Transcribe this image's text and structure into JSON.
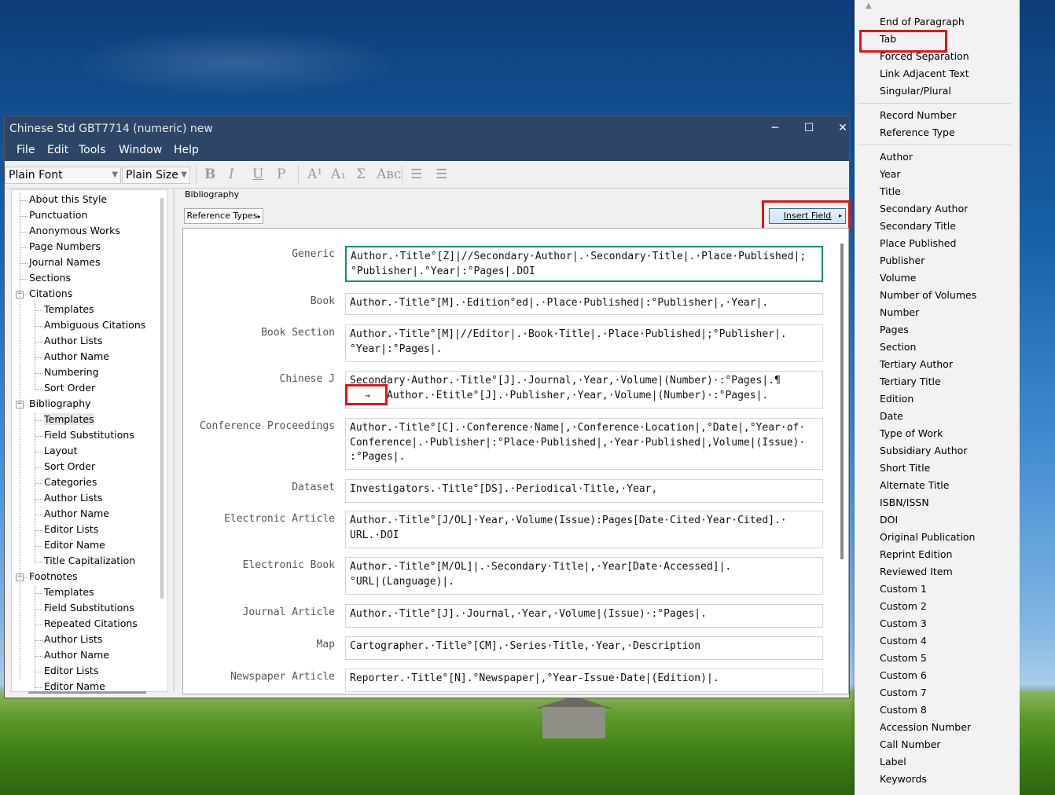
{
  "window": {
    "title": "Chinese Std GBT7714 (numeric) new",
    "controls": {
      "minimize": "─",
      "maximize": "☐",
      "close": "✕"
    }
  },
  "menu": [
    "File",
    "Edit",
    "Tools",
    "Window",
    "Help"
  ],
  "toolbar": {
    "font_value": "Plain Font",
    "size_value": "Plain Size",
    "bold": "B",
    "italic": "I",
    "underline": "U",
    "plain": "P",
    "superscript": "A¹",
    "subscript": "A₁",
    "symbol": "Σ",
    "smallcaps": "Aʙᴄ",
    "align_left": "☰",
    "justify": "☰"
  },
  "tree": [
    {
      "label": "About this Style",
      "level": 0
    },
    {
      "label": "Punctuation",
      "level": 0
    },
    {
      "label": "Anonymous Works",
      "level": 0
    },
    {
      "label": "Page Numbers",
      "level": 0
    },
    {
      "label": "Journal Names",
      "level": 0
    },
    {
      "label": "Sections",
      "level": 0
    },
    {
      "label": "Citations",
      "level": 0,
      "expanded": true
    },
    {
      "label": "Templates",
      "level": 1
    },
    {
      "label": "Ambiguous Citations",
      "level": 1
    },
    {
      "label": "Author Lists",
      "level": 1
    },
    {
      "label": "Author Name",
      "level": 1
    },
    {
      "label": "Numbering",
      "level": 1
    },
    {
      "label": "Sort Order",
      "level": 1
    },
    {
      "label": "Bibliography",
      "level": 0,
      "expanded": true
    },
    {
      "label": "Templates",
      "level": 1,
      "selected": true
    },
    {
      "label": "Field Substitutions",
      "level": 1
    },
    {
      "label": "Layout",
      "level": 1
    },
    {
      "label": "Sort Order",
      "level": 1
    },
    {
      "label": "Categories",
      "level": 1
    },
    {
      "label": "Author Lists",
      "level": 1
    },
    {
      "label": "Author Name",
      "level": 1
    },
    {
      "label": "Editor Lists",
      "level": 1
    },
    {
      "label": "Editor Name",
      "level": 1
    },
    {
      "label": "Title Capitalization",
      "level": 1
    },
    {
      "label": "Footnotes",
      "level": 0,
      "expanded": true
    },
    {
      "label": "Templates",
      "level": 1
    },
    {
      "label": "Field Substitutions",
      "level": 1
    },
    {
      "label": "Repeated Citations",
      "level": 1
    },
    {
      "label": "Author Lists",
      "level": 1
    },
    {
      "label": "Author Name",
      "level": 1
    },
    {
      "label": "Editor Lists",
      "level": 1
    },
    {
      "label": "Editor Name",
      "level": 1
    }
  ],
  "bibliography": {
    "section_label": "Bibliography",
    "reference_types_button": "Reference Types",
    "insert_field_button": "Insert Field",
    "tab_symbol": "→",
    "templates": [
      {
        "type": "Generic",
        "text": "Author.·Title°[Z]|//Secondary·Author|.·Secondary·Title|.·Place·Published|;°Publisher|.°Year|:°Pages|.DOI",
        "active": true
      },
      {
        "type": "Book",
        "text": "Author.·Title°[M].·Edition°ed|.·Place·Published|:°Publisher|,·Year|."
      },
      {
        "type": "Book Section",
        "text": "Author.·Title°[M]|//Editor|.·Book·Title|.·Place·Published|;°Publisher|.\n°Year|:°Pages|."
      },
      {
        "type": "Chinese J",
        "text": "Secondary·Author.·Title°[J].·Journal,·Year,·Volume|(Number)·:°Pages|.¶",
        "text2": "Author.·Etitle°[J].·Publisher,·Year,·Volume|(Number)·:°Pages|."
      },
      {
        "type": "Conference Proceedings",
        "text": "Author.·Title°[C].·Conference·Name|,·Conference·Location|,°Date|,°Year·of·\nConference|.·Publisher|:°Place·Published|,·Year·Published|,Volume|(Issue)·\n:°Pages|."
      },
      {
        "type": "Dataset",
        "text": "Investigators.·Title°[DS].·Periodical·Title,·Year,"
      },
      {
        "type": "Electronic Article",
        "text": "Author.·Title°[J/OL]·Year,·Volume(Issue):Pages[Date·Cited·Year·Cited].·\nURL.·DOI"
      },
      {
        "type": "Electronic Book",
        "text": "Author.·Title°[M/OL]|.·Secondary·Title|,·Year[Date·Accessed]|.\n°URL|(Language)|."
      },
      {
        "type": "Journal Article",
        "text": "Author.·Title°[J].·Journal,·Year,·Volume|(Issue)·:°Pages|."
      },
      {
        "type": "Map",
        "text": "Cartographer.·Title°[CM].·Series·Title,·Year,·Description"
      },
      {
        "type": "Newspaper Article",
        "text": "Reporter.·Title°[N].°Newspaper|,°Year-Issue·Date|(Edition)|."
      }
    ]
  },
  "insert_field_menu": {
    "group1": [
      "End of Paragraph",
      "Tab",
      "Forced Separation",
      "Link Adjacent Text",
      "Singular/Plural"
    ],
    "group2": [
      "Record Number",
      "Reference Type"
    ],
    "group3": [
      "Author",
      "Year",
      "Title",
      "Secondary Author",
      "Secondary Title",
      "Place Published",
      "Publisher",
      "Volume",
      "Number of Volumes",
      "Number",
      "Pages",
      "Section",
      "Tertiary Author",
      "Tertiary Title",
      "Edition",
      "Date",
      "Type of Work",
      "Subsidiary Author",
      "Short Title",
      "Alternate Title",
      "ISBN/ISSN",
      "DOI",
      "Original Publication",
      "Reprint Edition",
      "Reviewed Item",
      "Custom 1",
      "Custom 2",
      "Custom 3",
      "Custom 4",
      "Custom 5",
      "Custom 6",
      "Custom 7",
      "Custom 8",
      "Accession Number",
      "Call Number",
      "Label",
      "Keywords"
    ]
  },
  "highlight_color": "#e0141c",
  "active_border_color": "#1d8a7b"
}
